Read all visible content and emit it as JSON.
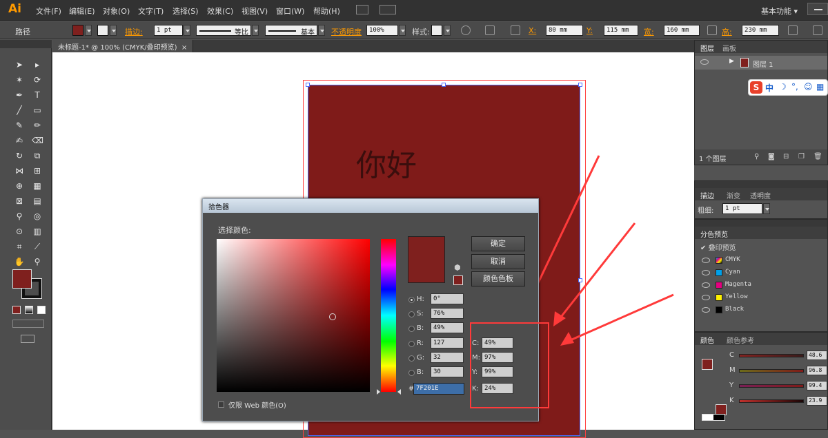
{
  "app": {
    "logo": "Ai"
  },
  "menu": [
    "文件(F)",
    "编辑(E)",
    "对象(O)",
    "文字(T)",
    "选择(S)",
    "效果(C)",
    "视图(V)",
    "窗口(W)",
    "帮助(H)"
  ],
  "workspace": "基本功能",
  "control_bar": {
    "object_type": "路径",
    "stroke_label": "描边:",
    "stroke_weight": "1 pt",
    "stroke_profile": "等比",
    "brush": "基本",
    "opacity_label": "不透明度",
    "opacity": "100%",
    "style_label": "样式:",
    "x_label": "X:",
    "x": "80 mm",
    "y_label": "Y:",
    "y": "115 mm",
    "w_label": "宽:",
    "w": "160 mm",
    "h_label": "高:",
    "h": "230 mm"
  },
  "document_tab": "未标题-1* @ 100% (CMYK/叠印预览)",
  "canvas": {
    "text": "你好",
    "fill_color": "#7f1b19"
  },
  "color_picker": {
    "title": "拾色器",
    "select_label": "选择颜色:",
    "ok": "确定",
    "cancel": "取消",
    "swatches": "颜色色板",
    "channels": {
      "h_label": "H:",
      "h": "0°",
      "s_label": "S:",
      "s": "76%",
      "b_label": "B:",
      "b": "49%",
      "r_label": "R:",
      "r": "127",
      "g_label": "G:",
      "g": "32",
      "bb_label": "B:",
      "bb": "30",
      "c_label": "C:",
      "c": "49%",
      "m_label": "M:",
      "m": "97%",
      "y_label": "Y:",
      "y": "99%",
      "k_label": "K:",
      "k": "24%"
    },
    "hash": "#",
    "hex": "7F201E",
    "web_only": "仅限 Web 颜色(O)",
    "current_color": "#7f201e"
  },
  "layers_panel": {
    "tabs": [
      "图层",
      "画板"
    ],
    "layer_name": "图层 1",
    "footer": "1 个图层"
  },
  "stroke_panel": {
    "tabs": [
      "描边",
      "渐变",
      "透明度"
    ],
    "weight_label": "粗细:",
    "weight": "1 pt"
  },
  "separations_panel": {
    "tab": "分色预览",
    "overprint": "叠印预览",
    "items": [
      {
        "name": "CMYK",
        "color": "#555555"
      },
      {
        "name": "Cyan",
        "color": "#00a0e9"
      },
      {
        "name": "Magenta",
        "color": "#e4007f"
      },
      {
        "name": "Yellow",
        "color": "#fff100"
      },
      {
        "name": "Black",
        "color": "#000000"
      }
    ]
  },
  "color_panel": {
    "tabs": [
      "颜色",
      "颜色参考"
    ],
    "rows": [
      {
        "label": "C",
        "value": "48.6"
      },
      {
        "label": "M",
        "value": "96.8"
      },
      {
        "label": "Y",
        "value": "99.4"
      },
      {
        "label": "K",
        "value": "23.9"
      }
    ]
  }
}
